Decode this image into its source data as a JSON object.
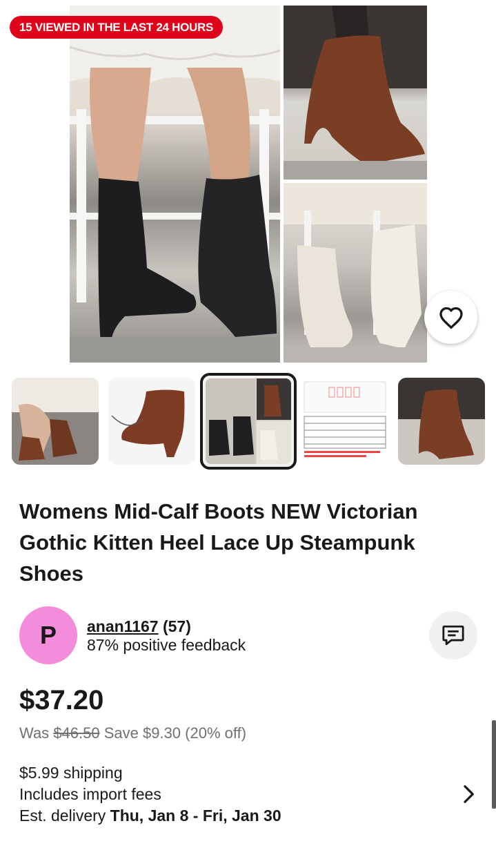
{
  "badge": {
    "viewed_text": "15 VIEWED IN THE LAST 24 HOURS"
  },
  "product": {
    "title": "Womens Mid-Calf Boots NEW Victorian Gothic Kitten Heel Lace Up Steampunk Shoes",
    "thumbnail_count": 5,
    "selected_thumbnail": 3
  },
  "seller": {
    "avatar_letter": "P",
    "username": "anan1167",
    "rating_count": "(57)",
    "feedback": "87% positive feedback"
  },
  "price": {
    "current": "$37.20",
    "was_label": "Was",
    "was_price": "$46.50",
    "savings": "Save $9.30 (20% off)"
  },
  "shipping": {
    "cost": "$5.99 shipping",
    "import_fees": "Includes import fees",
    "delivery_label": "Est. delivery",
    "delivery_dates": "Thu, Jan 8 - Fri, Jan 30"
  },
  "icons": {
    "favorite": "heart-icon",
    "message": "chat-icon",
    "details": "chevron-right-icon"
  },
  "colors": {
    "badge_red": "#e0041a",
    "avatar_pink": "#f38ddb",
    "text": "#191919",
    "muted": "#707070"
  }
}
